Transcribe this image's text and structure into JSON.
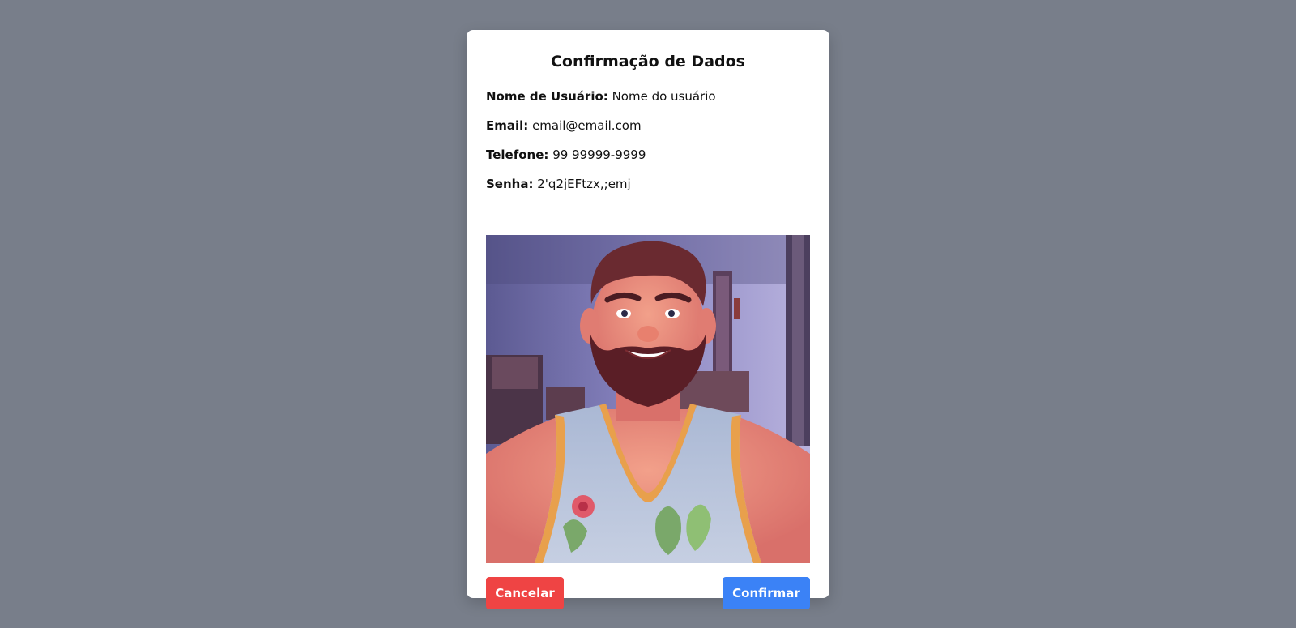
{
  "modal": {
    "title": "Confirmação de Dados",
    "fields": [
      {
        "label": "Nome de Usuário:",
        "value": "Nome do usuário"
      },
      {
        "label": "Email:",
        "value": "email@email.com"
      },
      {
        "label": "Telefone:",
        "value": "99 99999-9999"
      },
      {
        "label": "Senha:",
        "value": "2'q2jEFtzx,;emj"
      }
    ],
    "buttons": {
      "cancel_label": "Cancelar",
      "confirm_label": "Confirmar"
    }
  },
  "colors": {
    "backdrop": "#787e8a",
    "cancel": "#ef4444",
    "confirm": "#3b82f6"
  }
}
